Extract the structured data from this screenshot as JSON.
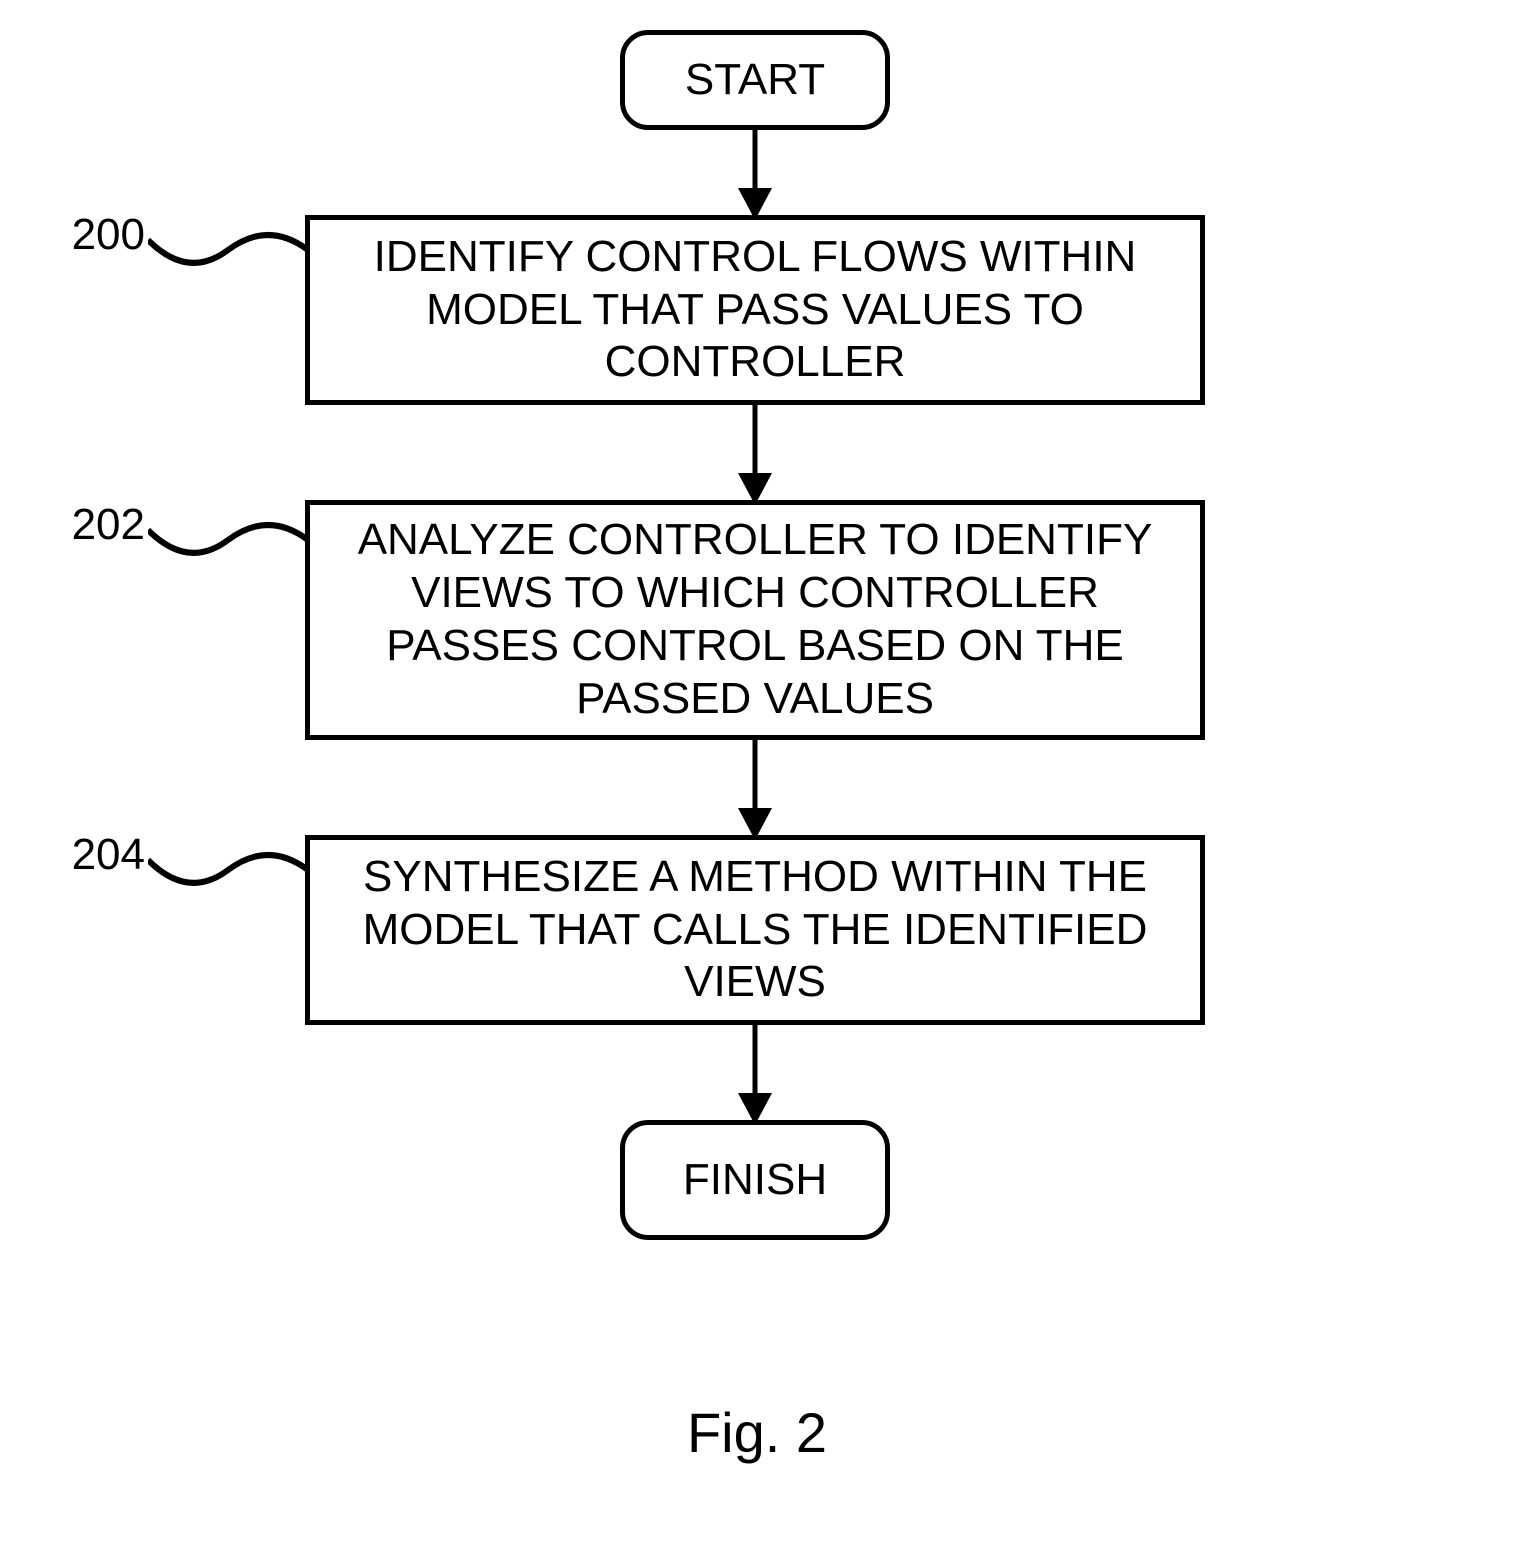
{
  "start": "START",
  "finish": "FINISH",
  "steps": {
    "s200": "IDENTIFY CONTROL FLOWS WITHIN MODEL THAT PASS VALUES TO CONTROLLER",
    "s202": "ANALYZE CONTROLLER TO IDENTIFY VIEWS TO WHICH CONTROLLER PASSES CONTROL BASED ON THE PASSED VALUES",
    "s204": "SYNTHESIZE A METHOD WITHIN THE MODEL THAT CALLS THE IDENTIFIED VIEWS"
  },
  "refs": {
    "r200": "200",
    "r202": "202",
    "r204": "204"
  },
  "figure": "Fig. 2"
}
